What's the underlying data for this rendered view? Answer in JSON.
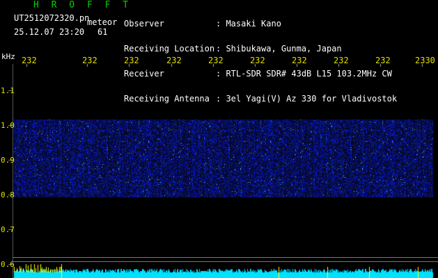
{
  "header": {
    "app_title": "H R O F F T",
    "file_name": "UT2512072320.pn",
    "meteor_label": "meteor",
    "date_time": "25.12.07 23:20",
    "count": "61",
    "observer_label": "Observer",
    "location_label": "Receiving Location",
    "receiver_label": "Receiver",
    "antenna_label": "Receiving Antenna",
    "observer_value": ": Masaki Kano",
    "location_value": ": Shibukawa, Gunma, Japan",
    "receiver_value": ": RTL-SDR SDR# 43dB L15 103.2MHz CW",
    "antenna_value": ": 3el Yagi(V) Az 330 for Vladivostok"
  },
  "plot": {
    "unit": "kHz",
    "x_ticks": [
      "232",
      "232",
      "232",
      "232",
      "232",
      "232",
      "232",
      "232",
      "232",
      "2330"
    ],
    "y_ticks": [
      "1.1",
      "1.0",
      "0.9",
      "0.8",
      "0.7",
      "0.6"
    ],
    "y_values": [
      1.1,
      1.0,
      0.9,
      0.8,
      0.7,
      0.6
    ],
    "signal_band": [
      0.8,
      1.0
    ],
    "colors": {
      "background": "#000000",
      "signal": "#1a3cff",
      "bright": "#66ccff",
      "bottom_bar": "#00e0ff",
      "spike": "#ffff00"
    }
  }
}
